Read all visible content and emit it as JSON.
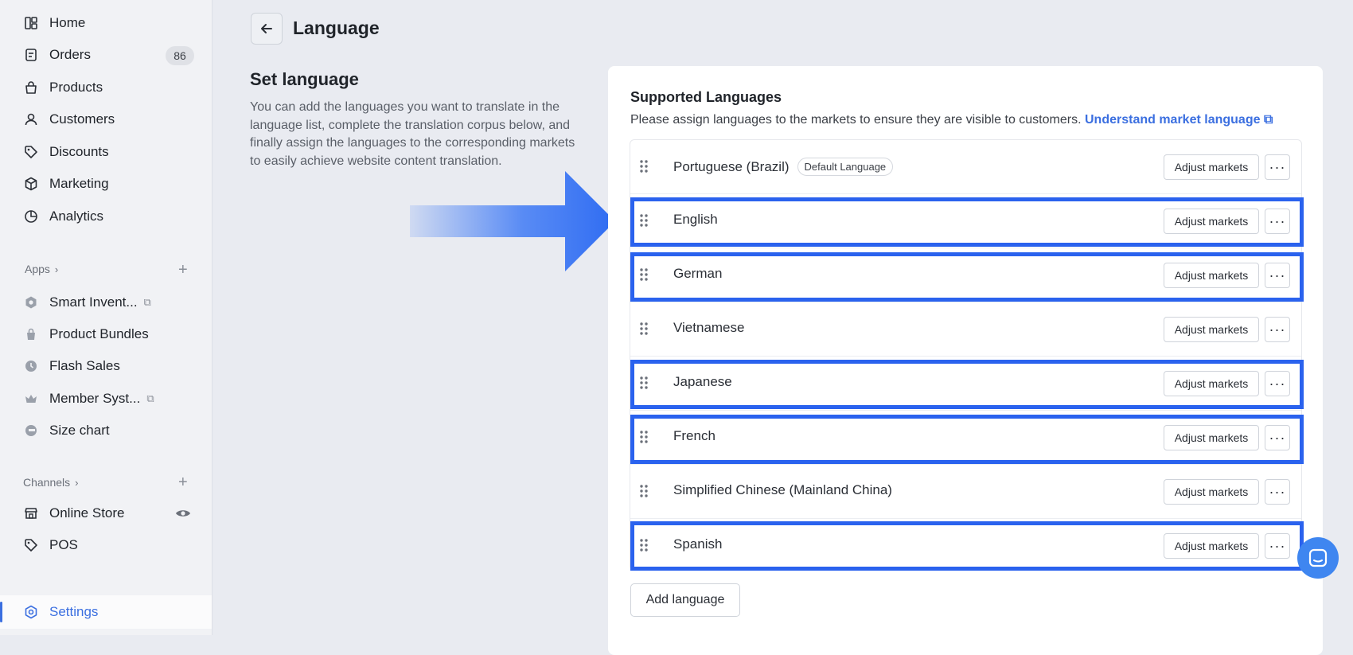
{
  "sidebar": {
    "items": [
      {
        "label": "Home",
        "icon": "dashboard-icon"
      },
      {
        "label": "Orders",
        "icon": "order-icon",
        "count": "86"
      },
      {
        "label": "Products",
        "icon": "bag-icon"
      },
      {
        "label": "Customers",
        "icon": "person-icon"
      },
      {
        "label": "Discounts",
        "icon": "tag-icon"
      },
      {
        "label": "Marketing",
        "icon": "cube-icon"
      },
      {
        "label": "Analytics",
        "icon": "pie-chart-icon"
      }
    ],
    "apps_label": "Apps",
    "apps": [
      {
        "label": "Smart Invent...",
        "icon": "hexagon-icon"
      },
      {
        "label": "Product Bundles",
        "icon": "bundle-bag-icon"
      },
      {
        "label": "Flash Sales",
        "icon": "clock-icon"
      },
      {
        "label": "Member Syst...",
        "icon": "crown-icon"
      },
      {
        "label": "Size chart",
        "icon": "size-icon"
      }
    ],
    "channels_label": "Channels",
    "channels": [
      {
        "label": "Online Store",
        "icon": "store-icon"
      },
      {
        "label": "POS",
        "icon": "pos-tag-icon"
      }
    ],
    "settings_label": "Settings",
    "accent": "#3b6fe0"
  },
  "header": {
    "title": "Language"
  },
  "intro": {
    "title": "Set language",
    "description": "You can add the languages you want to translate in the language list, complete the translation corpus below, and finally assign the languages to the corresponding markets to easily achieve website content translation."
  },
  "card": {
    "title": "Supported Languages",
    "subtitle": "Please assign languages to the markets to ensure they are visible to customers.",
    "link": "Understand market language",
    "default_tag": "Default Language",
    "adjust_label": "Adjust markets",
    "add_label": "Add language",
    "languages": [
      "Portuguese (Brazil)",
      "English",
      "German",
      "Vietnamese",
      "Japanese",
      "French",
      "Simplified Chinese (Mainland China)",
      "Spanish"
    ],
    "highlighted": [
      "English",
      "German",
      "Japanese",
      "French",
      "Spanish"
    ],
    "highlight_color": "#2a62ee"
  }
}
